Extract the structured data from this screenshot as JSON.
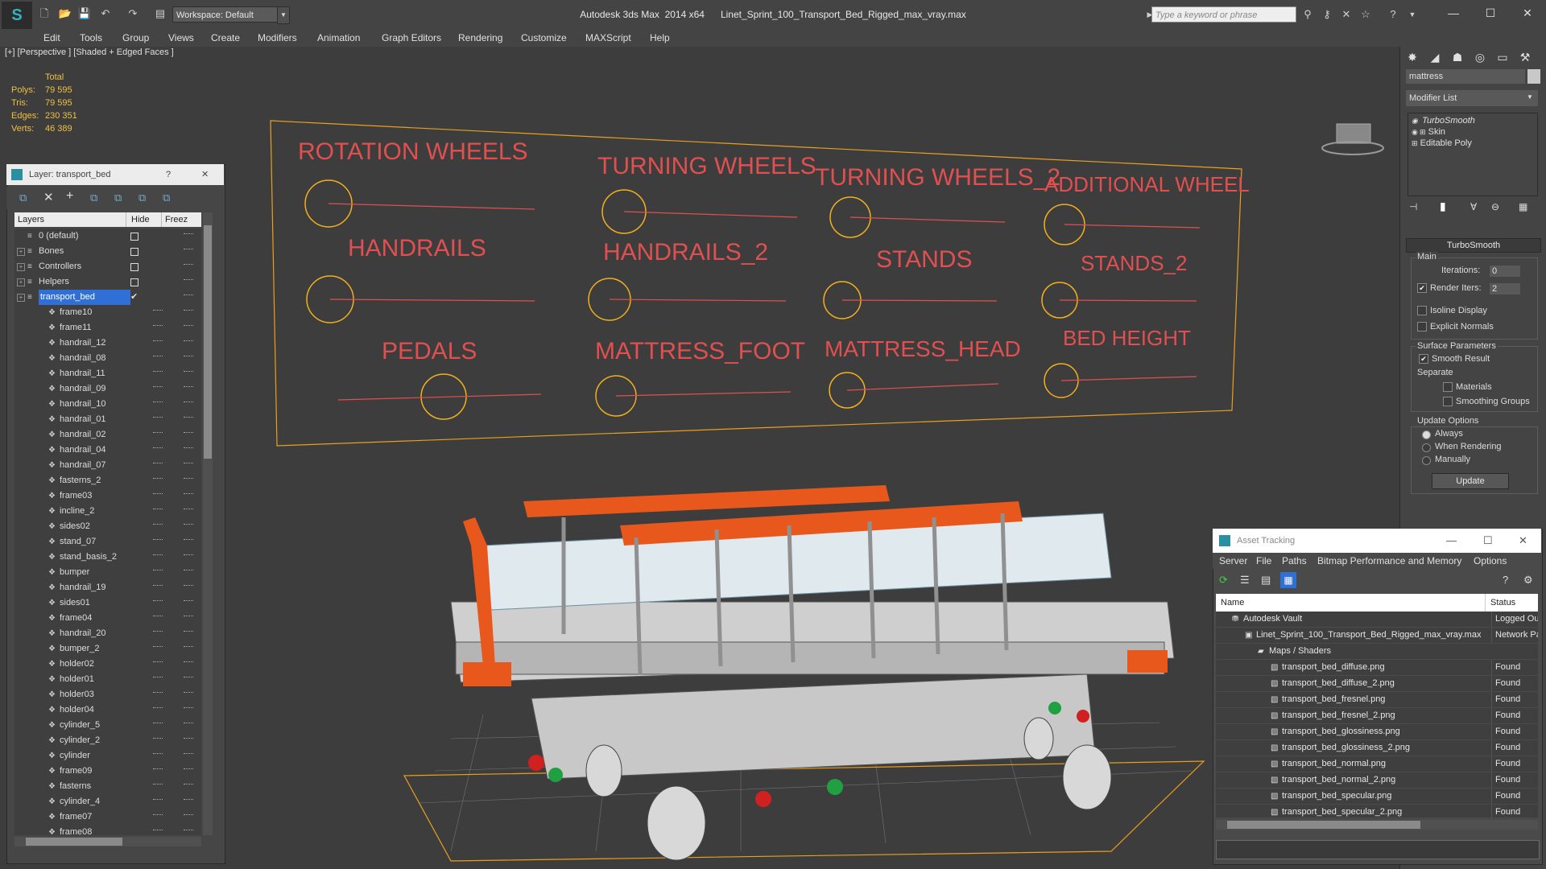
{
  "app": {
    "title": "Autodesk 3ds Max  2014 x64      Linet_Sprint_100_Transport_Bed_Rigged_max_vray.max",
    "workspace": "Workspace: Default",
    "search_placeholder": "Type a keyword or phrase"
  },
  "menu": [
    "Edit",
    "Tools",
    "Group",
    "Views",
    "Create",
    "Modifiers",
    "Animation",
    "Graph Editors",
    "Rendering",
    "Customize",
    "MAXScript",
    "Help"
  ],
  "viewport": {
    "label": "[+] [Perspective ] [Shaded + Edged Faces ]",
    "stats": {
      "header": "Total",
      "polys_label": "Polys:",
      "polys": "79 595",
      "tris_label": "Tris:",
      "tris": "79 595",
      "edges_label": "Edges:",
      "edges": "230 351",
      "verts_label": "Verts:",
      "verts": "46 389"
    },
    "controls": [
      "ROTATION  WHEELS",
      "TURNING WHEELS",
      "TURNING WHEELS_2",
      "ADDITIONAL WHEEL",
      "HANDRAILS",
      "HANDRAILS_2",
      "STANDS",
      "STANDS_2",
      "PEDALS",
      "MATTRESS_FOOT",
      "MATTRESS_HEAD",
      "BED HEIGHT"
    ],
    "colors": {
      "controls": "#e05050",
      "shapes": "#f0b020",
      "accent": "#e8581c"
    }
  },
  "layer_panel": {
    "title": "Layer: transport_bed",
    "help": "?",
    "close": "✕",
    "col_layers": "Layers",
    "col_hide": "Hide",
    "col_freeze": "Freez",
    "rows": [
      {
        "name": "0 (default)",
        "level": 0
      },
      {
        "name": "Bones",
        "level": 0
      },
      {
        "name": "Controllers",
        "level": 0
      },
      {
        "name": "Helpers",
        "level": 0
      },
      {
        "name": "transport_bed",
        "level": 0,
        "selected": true
      },
      {
        "name": "frame10",
        "level": 1
      },
      {
        "name": "frame11",
        "level": 1
      },
      {
        "name": "handrail_12",
        "level": 1
      },
      {
        "name": "handrail_08",
        "level": 1
      },
      {
        "name": "handrail_11",
        "level": 1
      },
      {
        "name": "handrail_09",
        "level": 1
      },
      {
        "name": "handrail_10",
        "level": 1
      },
      {
        "name": "handrail_01",
        "level": 1
      },
      {
        "name": "handrail_02",
        "level": 1
      },
      {
        "name": "handrail_04",
        "level": 1
      },
      {
        "name": "handrail_07",
        "level": 1
      },
      {
        "name": "fasterns_2",
        "level": 1
      },
      {
        "name": "frame03",
        "level": 1
      },
      {
        "name": "incline_2",
        "level": 1
      },
      {
        "name": "sides02",
        "level": 1
      },
      {
        "name": "stand_07",
        "level": 1
      },
      {
        "name": "stand_basis_2",
        "level": 1
      },
      {
        "name": "bumper",
        "level": 1
      },
      {
        "name": "handrail_19",
        "level": 1
      },
      {
        "name": "sides01",
        "level": 1
      },
      {
        "name": "frame04",
        "level": 1
      },
      {
        "name": "handrail_20",
        "level": 1
      },
      {
        "name": "bumper_2",
        "level": 1
      },
      {
        "name": "holder02",
        "level": 1
      },
      {
        "name": "holder01",
        "level": 1
      },
      {
        "name": "holder03",
        "level": 1
      },
      {
        "name": "holder04",
        "level": 1
      },
      {
        "name": "cylinder_5",
        "level": 1
      },
      {
        "name": "cylinder_2",
        "level": 1
      },
      {
        "name": "cylinder",
        "level": 1
      },
      {
        "name": "frame09",
        "level": 1
      },
      {
        "name": "fasterns",
        "level": 1
      },
      {
        "name": "cylinder_4",
        "level": 1
      },
      {
        "name": "frame07",
        "level": 1
      },
      {
        "name": "frame08",
        "level": 1
      }
    ]
  },
  "command_panel": {
    "object_name": "mattress",
    "modifier_list": "Modifier List",
    "stack": [
      "TurboSmooth",
      "Skin",
      "Editable Poly"
    ],
    "rollout": "TurboSmooth",
    "main": "Main",
    "iterations_label": "Iterations:",
    "iterations": "0",
    "render_iters_label": "Render Iters:",
    "render_iters": "2",
    "isoline": "Isoline Display",
    "explicit_normals": "Explicit Normals",
    "surface_params": "Surface Parameters",
    "smooth_result": "Smooth Result",
    "separate": "Separate",
    "materials": "Materials",
    "smoothing_groups": "Smoothing Groups",
    "update_options": "Update Options",
    "always": "Always",
    "when_rendering": "When Rendering",
    "manually": "Manually",
    "update_btn": "Update"
  },
  "asset_tracking": {
    "title": "Asset Tracking",
    "menu": [
      "Server",
      "File",
      "Paths",
      "Bitmap Performance and Memory",
      "Options"
    ],
    "col_name": "Name",
    "col_status": "Status",
    "rows": [
      {
        "name": "Autodesk Vault",
        "status": "Logged Out",
        "level": 0
      },
      {
        "name": "Linet_Sprint_100_Transport_Bed_Rigged_max_vray.max",
        "status": "Network Pa",
        "level": 1
      },
      {
        "name": "Maps / Shaders",
        "status": "",
        "level": 2
      },
      {
        "name": "transport_bed_diffuse.png",
        "status": "Found",
        "level": 3
      },
      {
        "name": "transport_bed_diffuse_2.png",
        "status": "Found",
        "level": 3
      },
      {
        "name": "transport_bed_fresnel.png",
        "status": "Found",
        "level": 3
      },
      {
        "name": "transport_bed_fresnel_2.png",
        "status": "Found",
        "level": 3
      },
      {
        "name": "transport_bed_glossiness.png",
        "status": "Found",
        "level": 3
      },
      {
        "name": "transport_bed_glossiness_2.png",
        "status": "Found",
        "level": 3
      },
      {
        "name": "transport_bed_normal.png",
        "status": "Found",
        "level": 3
      },
      {
        "name": "transport_bed_normal_2.png",
        "status": "Found",
        "level": 3
      },
      {
        "name": "transport_bed_specular.png",
        "status": "Found",
        "level": 3
      },
      {
        "name": "transport_bed_specular_2.png",
        "status": "Found",
        "level": 3
      }
    ]
  }
}
